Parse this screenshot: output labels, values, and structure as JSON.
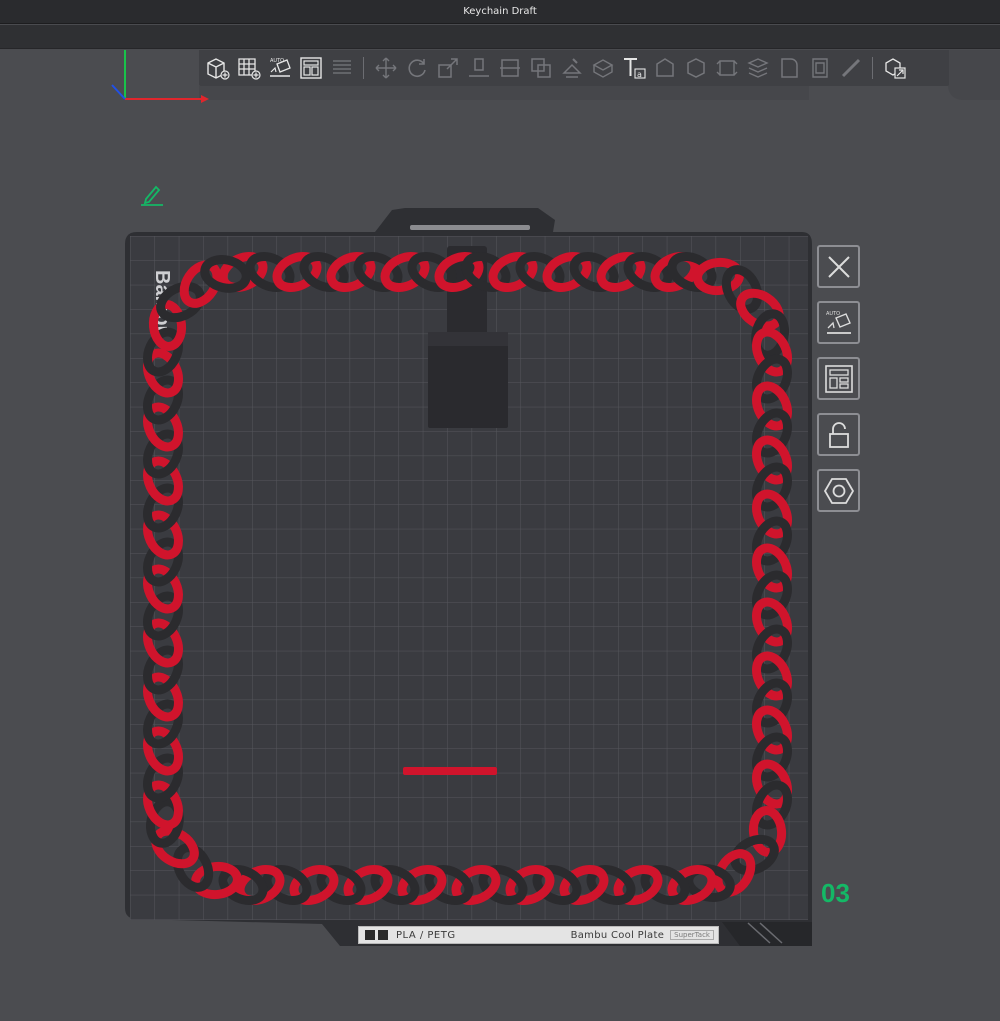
{
  "window": {
    "title": "Keychain Draft"
  },
  "toolbar": {
    "items": [
      {
        "name": "add-part-icon"
      },
      {
        "name": "add-plate-icon"
      },
      {
        "name": "auto-orient-icon"
      },
      {
        "name": "arrange-icon"
      },
      {
        "name": "split-objects-icon"
      },
      {
        "name": "move-icon"
      },
      {
        "name": "rotate-icon"
      },
      {
        "name": "scale-icon"
      },
      {
        "name": "lay-on-face-icon"
      },
      {
        "name": "cut-icon"
      },
      {
        "name": "mesh-boolean-icon"
      },
      {
        "name": "support-paint-icon"
      },
      {
        "name": "seam-paint-icon"
      },
      {
        "name": "text-tool-icon"
      },
      {
        "name": "measure-icon"
      },
      {
        "name": "assembly-icon"
      },
      {
        "name": "emboss-icon"
      },
      {
        "name": "variable-height-icon"
      },
      {
        "name": "fuzzy-skin-icon"
      },
      {
        "name": "brim-ears-icon"
      },
      {
        "name": "paint-brush-icon"
      },
      {
        "name": "view-mode-icon"
      }
    ]
  },
  "side_tools": [
    {
      "name": "delete-plate-button",
      "icon": "close-icon"
    },
    {
      "name": "auto-orient-plate-button",
      "icon": "auto-orient-icon"
    },
    {
      "name": "arrange-plate-button",
      "icon": "arrange-icon"
    },
    {
      "name": "lock-plate-button",
      "icon": "lock-icon"
    },
    {
      "name": "plate-settings-button",
      "icon": "settings-hex-icon"
    }
  ],
  "plate": {
    "number": "03",
    "material": "PLA / PETG",
    "plate_type": "Bambu Cool Plate",
    "surface_tag": "SuperTack",
    "bed_brand_text": "Bambu"
  },
  "colors": {
    "accent_green": "#14b866",
    "chain_red": "#d0142c",
    "chain_black": "#2b2b2e",
    "bed": "#3a3b40"
  }
}
